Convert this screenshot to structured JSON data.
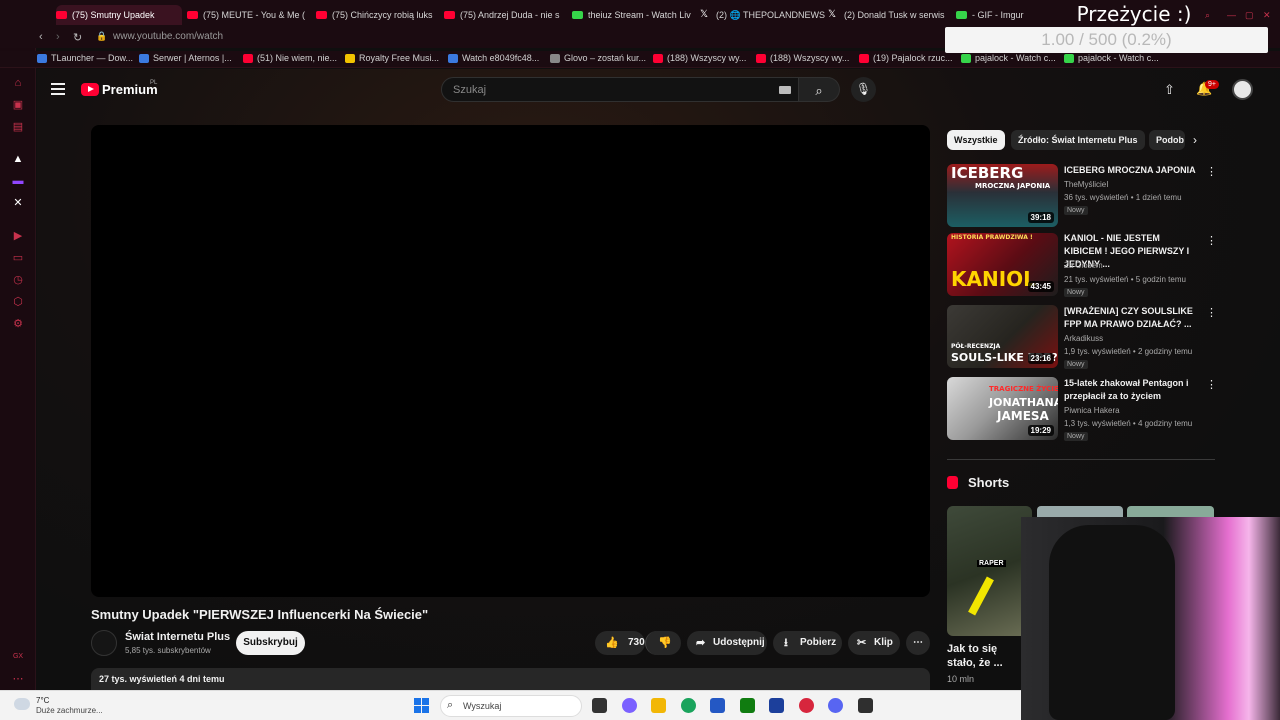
{
  "browser": {
    "tabs": [
      {
        "label": "(75) Smutny Upadek",
        "active": true,
        "icon": "youtube-icon"
      },
      {
        "label": "(75) MEUTE - You & Me (",
        "icon": "youtube-icon"
      },
      {
        "label": "(75) Chińczycy robią luks",
        "icon": "youtube-icon"
      },
      {
        "label": "(75) Andrzej Duda - nie s",
        "icon": "youtube-icon"
      },
      {
        "label": "theiuz Stream - Watch Liv",
        "icon": "kick-icon"
      },
      {
        "label": "(2) 🌐 THEPOLANDNEWS 🌐",
        "icon": "x-icon"
      },
      {
        "label": "(2) Donald Tusk w serwis",
        "icon": "x-icon"
      },
      {
        "label": "- GIF - Imgur",
        "icon": "imgur-icon"
      }
    ],
    "url": "www.youtube.com/watch",
    "bookmarks": [
      "TLauncher — Dow...",
      "Serwer | Aternos |...",
      "(51) Nie wiem, nie...",
      "Royalty Free Musi...",
      "Watch e8049fc48...",
      "Glovo – zostań kur...",
      "(188) Wszyscy wy...",
      "(188) Wszyscy wy...",
      "(19) Pajalock rzuc...",
      "pajalock - Watch c...",
      "pajalock - Watch c..."
    ]
  },
  "overlay": {
    "title": "Przeżycie :)",
    "progress_text": "1.00 / 500 (0.2%)",
    "progress_value": 0.002
  },
  "youtube": {
    "logo_text": "Premium",
    "logo_region": "PL",
    "search_placeholder": "Szukaj",
    "notifications_badge": "9+",
    "video": {
      "title": "Smutny Upadek \"PIERWSZEJ Influencerki Na Świecie\"",
      "channel": "Świat Internetu Plus",
      "subscribers": "5,85 tys. subskrybentów",
      "subscribe_label": "Subskrybuj",
      "likes": "730",
      "share_label": "Udostępnij",
      "download_label": "Pobierz",
      "clip_label": "Klip",
      "views_date": "27 tys. wyświetleń  4 dni temu"
    },
    "chips": [
      "Wszystkie",
      "Źródło: Świat Internetu Plus",
      "Podob"
    ],
    "recommendations": [
      {
        "title": "ICEBERG MROCZNA JAPONIA",
        "channel": "TheMyślicieI",
        "meta": "36 tys. wyświetleń • 1 dzień temu",
        "badge": "Nowy",
        "duration": "39:18",
        "thumb_text": [
          "ICEBERG",
          "MROCZNA JAPONIA"
        ]
      },
      {
        "title": "KANIOL - NIE JESTEM KIBICEM ! JEGO PIERWSZY I JEDYNY ...",
        "channel": "Za Ciosem",
        "meta": "21 tys. wyświetleń • 5 godzin temu",
        "badge": "Nowy",
        "duration": "43:45",
        "thumb_text": [
          "HISTORIA PRAWDZIWA !",
          "KANIOL"
        ]
      },
      {
        "title": "[WRAŻENIA] CZY SOULSLIKE FPP MA PRAWO DZIAŁAĆ? ...",
        "channel": "Arkadikuss",
        "meta": "1,9 tys. wyświetleń • 2 godziny temu",
        "badge": "Nowy",
        "duration": "23:16",
        "thumb_text": [
          "PÓŁ-RECENZJA",
          "SOULS-LIKE FPP?"
        ]
      },
      {
        "title": "15-latek zhakował Pentagon i przepłacił za to życiem",
        "channel": "Piwnica Hakera",
        "meta": "1,3 tys. wyświetleń • 4 godziny temu",
        "badge": "Nowy",
        "duration": "19:29",
        "thumb_text": [
          "TRAGICZNE ŻYCIE",
          "JONATHANA",
          "JAMESA"
        ]
      }
    ],
    "shorts": {
      "heading": "Shorts",
      "items": [
        {
          "title": "Jak to się stało, że ...",
          "views": "10 mln",
          "tag": "RAPER"
        }
      ]
    }
  },
  "taskbar": {
    "temperature": "7°C",
    "weather": "Duże zachmurze...",
    "search_placeholder": "Wyszukaj"
  },
  "colors": {
    "yt_red": "#ff0033",
    "opera_red": "#c8324d",
    "bg": "#0f0f0f"
  }
}
